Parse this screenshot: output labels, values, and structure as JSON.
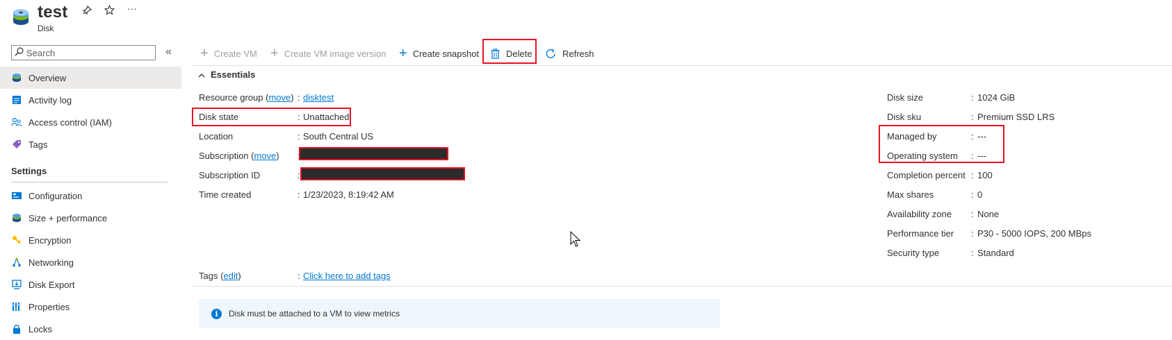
{
  "header": {
    "title": "test",
    "subtitle": "Disk",
    "pin_icon": "pin-icon",
    "star_icon": "star-icon",
    "more_label": "···"
  },
  "sidebar": {
    "search_placeholder": "Search",
    "collapse_label": "«",
    "items": [
      {
        "label": "Overview",
        "icon": "disk-icon",
        "active": true
      },
      {
        "label": "Activity log",
        "icon": "activity-log-icon"
      },
      {
        "label": "Access control (IAM)",
        "icon": "people-icon"
      },
      {
        "label": "Tags",
        "icon": "tag-icon"
      }
    ],
    "settings_header": "Settings",
    "settings_items": [
      {
        "label": "Configuration",
        "icon": "configuration-icon"
      },
      {
        "label": "Size + performance",
        "icon": "disk-icon"
      },
      {
        "label": "Encryption",
        "icon": "key-icon"
      },
      {
        "label": "Networking",
        "icon": "networking-icon"
      },
      {
        "label": "Disk Export",
        "icon": "export-icon"
      },
      {
        "label": "Properties",
        "icon": "properties-icon"
      },
      {
        "label": "Locks",
        "icon": "lock-icon"
      }
    ]
  },
  "toolbar": {
    "create_vm": "Create VM",
    "create_image_version": "Create VM image version",
    "create_snapshot": "Create snapshot",
    "delete": "Delete",
    "refresh": "Refresh"
  },
  "essentials": {
    "title": "Essentials",
    "left": {
      "resource_group_label": "Resource group",
      "move_link": "move",
      "resource_group_value": "disktest",
      "disk_state_label": "Disk state",
      "disk_state_value": "Unattached",
      "location_label": "Location",
      "location_value": "South Central US",
      "subscription_label": "Subscription",
      "subscription_id_label": "Subscription ID",
      "time_created_label": "Time created",
      "time_created_value": "1/23/2023, 8:19:42 AM"
    },
    "right": {
      "disk_size_label": "Disk size",
      "disk_size_value": "1024 GiB",
      "disk_sku_label": "Disk sku",
      "disk_sku_value": "Premium SSD LRS",
      "managed_by_label": "Managed by",
      "managed_by_value": "---",
      "os_label": "Operating system",
      "os_value": "---",
      "completion_label": "Completion percent",
      "completion_value": "100",
      "max_shares_label": "Max shares",
      "max_shares_value": "0",
      "availability_zone_label": "Availability zone",
      "availability_zone_value": "None",
      "performance_tier_label": "Performance tier",
      "performance_tier_value": "P30 - 5000 IOPS, 200 MBps",
      "security_type_label": "Security type",
      "security_type_value": "Standard"
    },
    "tags_label": "Tags",
    "edit_link": "edit",
    "tags_value": "Click here to add tags",
    "colon": ":"
  },
  "banner": {
    "icon": "info-icon",
    "text": "Disk must be attached to a VM to view metrics"
  },
  "colors": {
    "accent": "#0078d4",
    "highlight": "#e81123",
    "active_nav": "#edebe9"
  }
}
